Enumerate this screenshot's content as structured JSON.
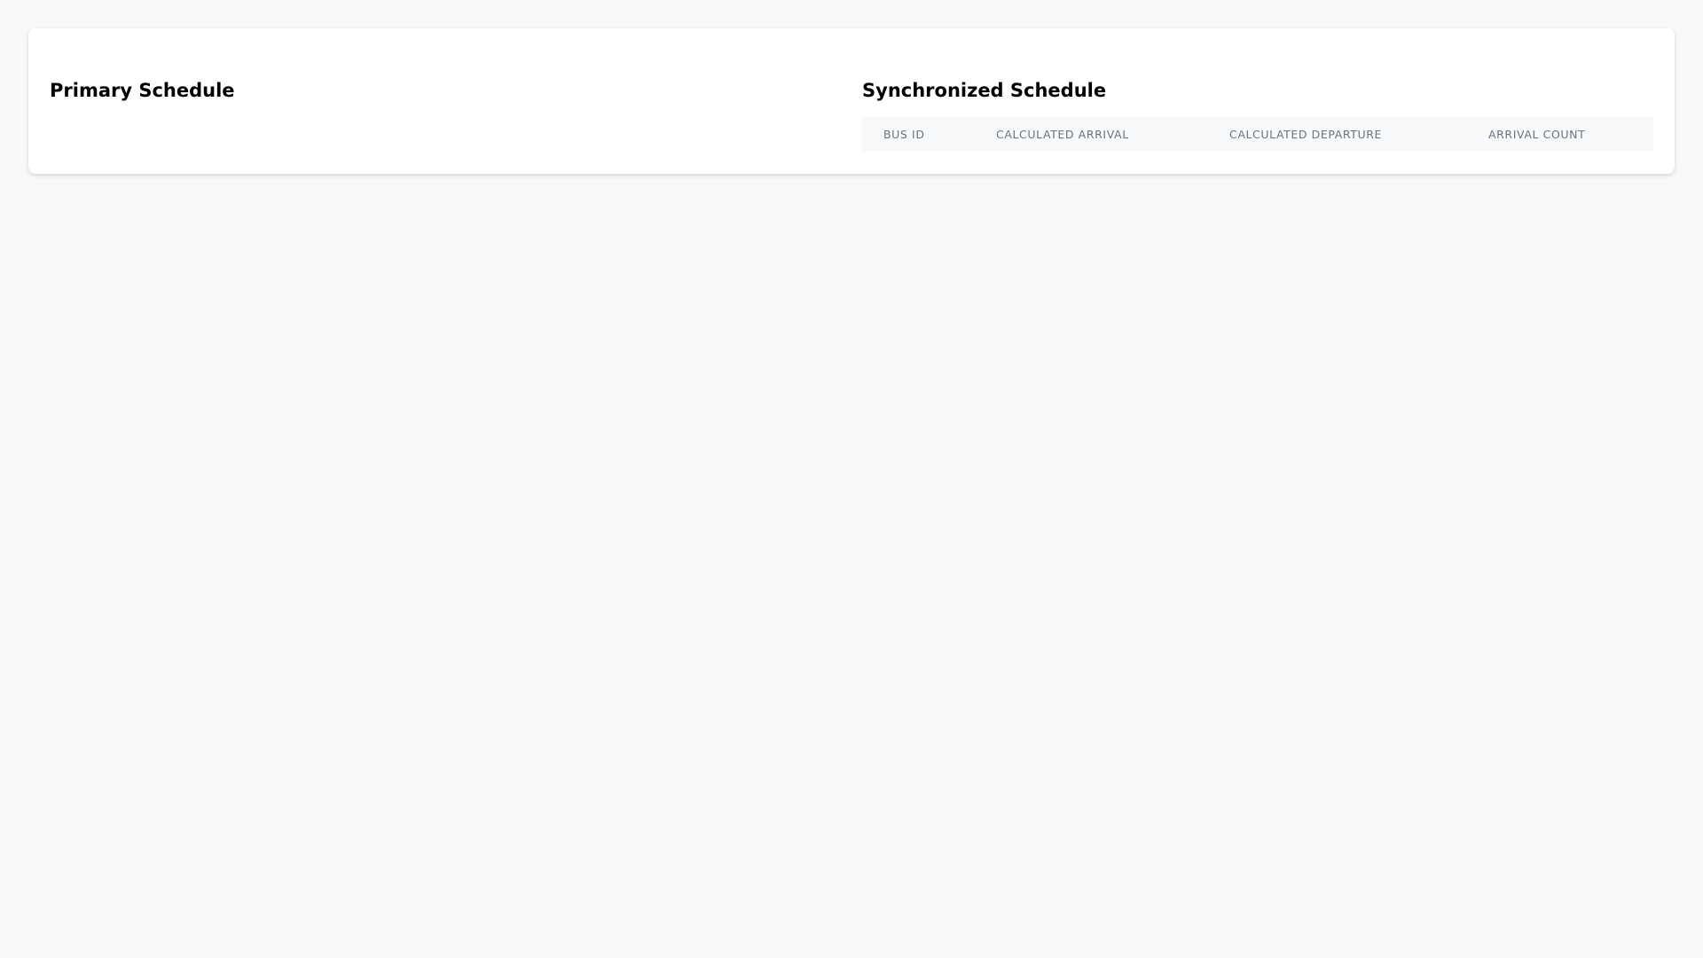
{
  "primary": {
    "title": "Primary Schedule"
  },
  "synchronized": {
    "title": "Synchronized Schedule",
    "columns": [
      "BUS ID",
      "CALCULATED ARRIVAL",
      "CALCULATED DEPARTURE",
      "ARRIVAL COUNT"
    ]
  }
}
